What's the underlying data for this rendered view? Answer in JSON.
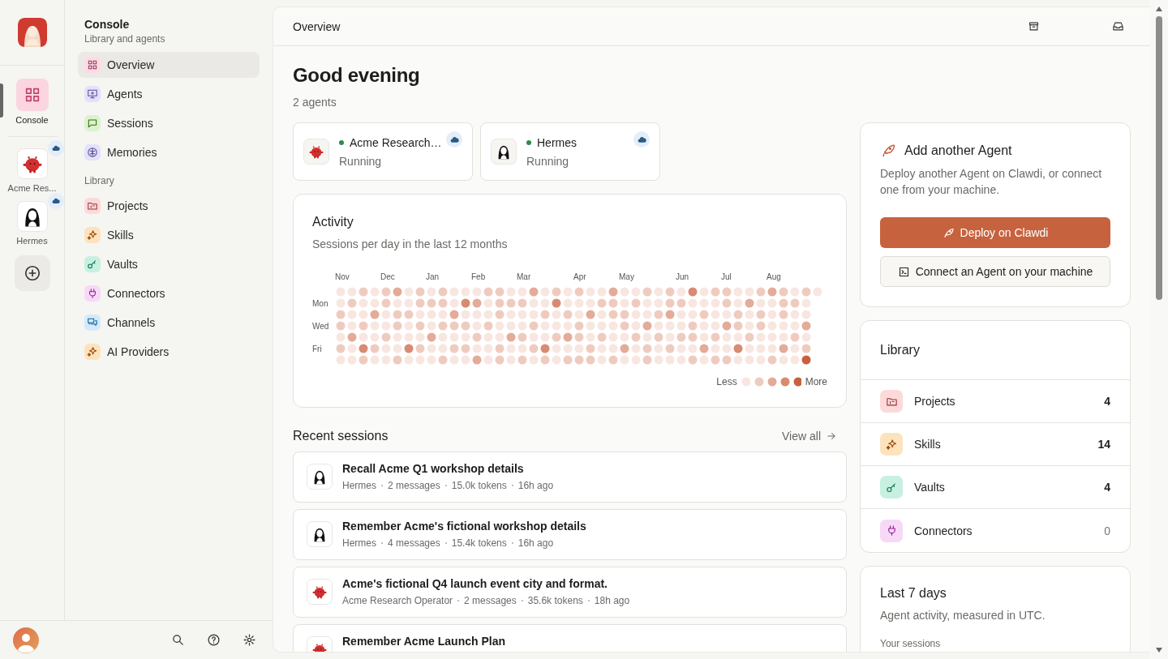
{
  "rail": {
    "items": [
      {
        "label": "Console",
        "kind": "overview",
        "selected": true
      }
    ],
    "agents": [
      {
        "label": "Acme Res...",
        "kind": "robot",
        "cloud": true
      },
      {
        "label": "Hermes",
        "kind": "figure",
        "cloud": true
      }
    ]
  },
  "sidebar": {
    "title": "Console",
    "subtitle": "Library and agents",
    "groups": [
      {
        "items": [
          {
            "label": "Overview",
            "kind": "overview",
            "color": "#fcdbe5",
            "selected": true
          },
          {
            "label": "Agents",
            "kind": "agents",
            "color": "#e5e0fa",
            "selected": false
          },
          {
            "label": "Sessions",
            "kind": "sessions",
            "color": "#dcf2cf",
            "selected": false
          },
          {
            "label": "Memories",
            "kind": "memories",
            "color": "#e3e2fb",
            "selected": false
          }
        ]
      },
      {
        "heading": "Library",
        "items": [
          {
            "label": "Projects",
            "kind": "projects",
            "color": "#fddada",
            "selected": false
          },
          {
            "label": "Skills",
            "kind": "skills",
            "color": "#fde3bd",
            "selected": false
          },
          {
            "label": "Vaults",
            "kind": "vaults",
            "color": "#c7f0e1",
            "selected": false
          },
          {
            "label": "Connectors",
            "kind": "connectors",
            "color": "#f8d8f7",
            "selected": false
          },
          {
            "label": "Channels",
            "kind": "channels",
            "color": "#d4eafb",
            "selected": false
          },
          {
            "label": "AI Providers",
            "kind": "skills",
            "color": "#fde3bd",
            "selected": false
          }
        ]
      }
    ]
  },
  "header": {
    "title": "Overview"
  },
  "greeting": "Good evening",
  "agent_count": "2 agents",
  "agents": [
    {
      "name": "Acme Research…",
      "status": "Running",
      "online": true,
      "kind": "robot",
      "cloud": true
    },
    {
      "name": "Hermes",
      "status": "Running",
      "online": true,
      "kind": "figure",
      "cloud": true
    }
  ],
  "activity": {
    "title": "Activity",
    "subtitle": "Sessions per day in the last 12 months",
    "months": [
      "Nov",
      "Dec",
      "Jan",
      "Feb",
      "Mar",
      "Apr",
      "May",
      "Jun",
      "Jul",
      "Aug"
    ],
    "days": [
      "Mon",
      "Wed",
      "Fri"
    ],
    "legend": {
      "less": "Less",
      "more": "More"
    }
  },
  "recent": {
    "title": "Recent sessions",
    "view_all": "View all",
    "sessions": [
      {
        "title": "Recall Acme Q1 workshop details",
        "kind": "figure",
        "meta": [
          "Hermes",
          "2 messages",
          "15.0k tokens",
          "16h ago"
        ]
      },
      {
        "title": "Remember Acme's fictional workshop details",
        "kind": "figure",
        "meta": [
          "Hermes",
          "4 messages",
          "15.4k tokens",
          "16h ago"
        ]
      },
      {
        "title": "Acme's fictional Q4 launch event city and format.",
        "kind": "robot",
        "meta": [
          "Acme Research Operator",
          "2 messages",
          "35.6k tokens",
          "18h ago"
        ]
      },
      {
        "title": "Remember Acme Launch Plan",
        "kind": "robot"
      }
    ]
  },
  "add_agent": {
    "title": "Add another Agent",
    "text": "Deploy another Agent on Clawdi, or connect one from your machine.",
    "primary": "Deploy on Clawdi",
    "secondary": "Connect an Agent on your machine"
  },
  "library": {
    "title": "Library",
    "rows": [
      {
        "label": "Projects",
        "kind": "projects",
        "color": "#fddada",
        "count": "4",
        "muted": false
      },
      {
        "label": "Skills",
        "kind": "skills",
        "color": "#fde3bd",
        "count": "14",
        "muted": false
      },
      {
        "label": "Vaults",
        "kind": "vaults",
        "color": "#c7f0e1",
        "count": "4",
        "muted": false
      },
      {
        "label": "Connectors",
        "kind": "connectors",
        "color": "#f8d8f7",
        "count": "0",
        "muted": true
      }
    ]
  },
  "last7": {
    "title": "Last 7 days",
    "subtitle": "Agent activity, measured in UTC.",
    "section": "Your sessions"
  }
}
